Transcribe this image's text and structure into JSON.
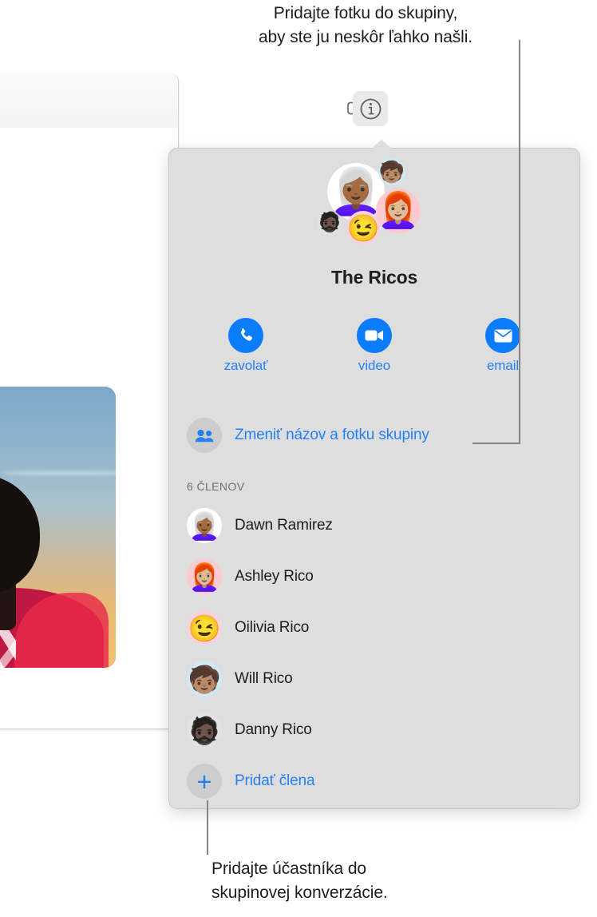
{
  "callouts": {
    "top": "Pridajte fotku do skupiny,\naby ste ju neskôr ľahko našli.",
    "bottom": "Pridajte účastníka do\nskupinovej konverzácie."
  },
  "toolbar": {
    "video_icon": "video-camera-icon",
    "info_icon": "info-circle-icon"
  },
  "popover": {
    "group_title": "The Ricos",
    "actions": [
      {
        "label": "zavolať",
        "icon": "phone-icon"
      },
      {
        "label": "video",
        "icon": "video-camera-icon"
      },
      {
        "label": "email",
        "icon": "envelope-icon"
      }
    ],
    "change_group": {
      "label": "Zmeniť názov a fotku skupiny",
      "icon": "two-people-icon"
    },
    "members_heading": "6 ČLENOV",
    "members": [
      {
        "name": "Dawn Ramirez",
        "avatar_glyph": "👩🏾‍🦳",
        "avatar_bg": "#ffffff"
      },
      {
        "name": "Ashley Rico",
        "avatar_glyph": "👩🏼‍🦰",
        "avatar_bg": "#fcc9ce"
      },
      {
        "name": "Oilivia Rico",
        "avatar_glyph": "😉",
        "avatar_bg": "#fbd0e2"
      },
      {
        "name": "Will Rico",
        "avatar_glyph": "🧒🏽",
        "avatar_bg": "#cdeaf8"
      },
      {
        "name": "Danny Rico",
        "avatar_glyph": "🧔🏿",
        "avatar_bg": "#e2e2e2"
      }
    ],
    "add_member": {
      "label": "Pridať člena",
      "icon": "plus-icon"
    },
    "cluster": [
      {
        "name": "Dawn Ramirez",
        "avatar_glyph": "👩🏾‍🦳",
        "avatar_bg": "#ffffff"
      },
      {
        "name": "Will Rico",
        "avatar_glyph": "🧒🏽",
        "avatar_bg": "#cdeaf8"
      },
      {
        "name": "Ashley Rico",
        "avatar_glyph": "👩🏼‍🦰",
        "avatar_bg": "#fcc9ce"
      },
      {
        "name": "Danny Rico",
        "avatar_glyph": "🧔🏿",
        "avatar_bg": "#e2e2e2"
      },
      {
        "name": "Oilivia Rico",
        "avatar_glyph": "😉",
        "avatar_bg": "#fbd0e2"
      }
    ]
  },
  "colors": {
    "accent_blue": "#2680f5",
    "button_blue": "#0b7cfb",
    "popover_bg": "#dedede",
    "leader_line": "#858585"
  }
}
